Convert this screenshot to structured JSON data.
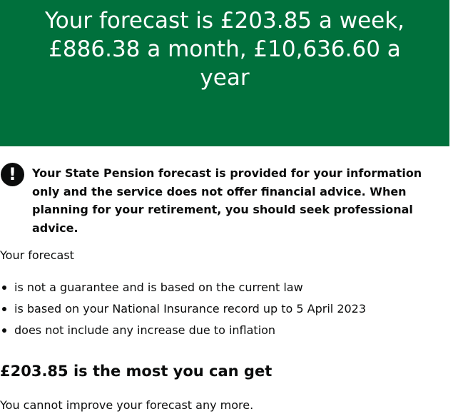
{
  "panel": {
    "title": "Your forecast is £203.85 a week, £886.38 a month, £10,636.60 a year"
  },
  "warning": {
    "icon_symbol": "!",
    "icon_name": "exclamation-icon",
    "text": "Your State Pension forecast is provided for your information only and the service does not offer financial advice. When planning for your retirement, you should seek professional advice."
  },
  "forecast": {
    "intro": "Your forecast",
    "bullets": [
      "is not a guarantee and is based on the current law",
      "is based on your National Insurance record up to 5 April 2023",
      "does not include any increase due to inflation"
    ]
  },
  "max": {
    "heading": "£203.85 is the most you can get",
    "body": "You cannot improve your forecast any more."
  },
  "colors": {
    "panel_bg": "#00703c",
    "text": "#0b0c0c"
  }
}
